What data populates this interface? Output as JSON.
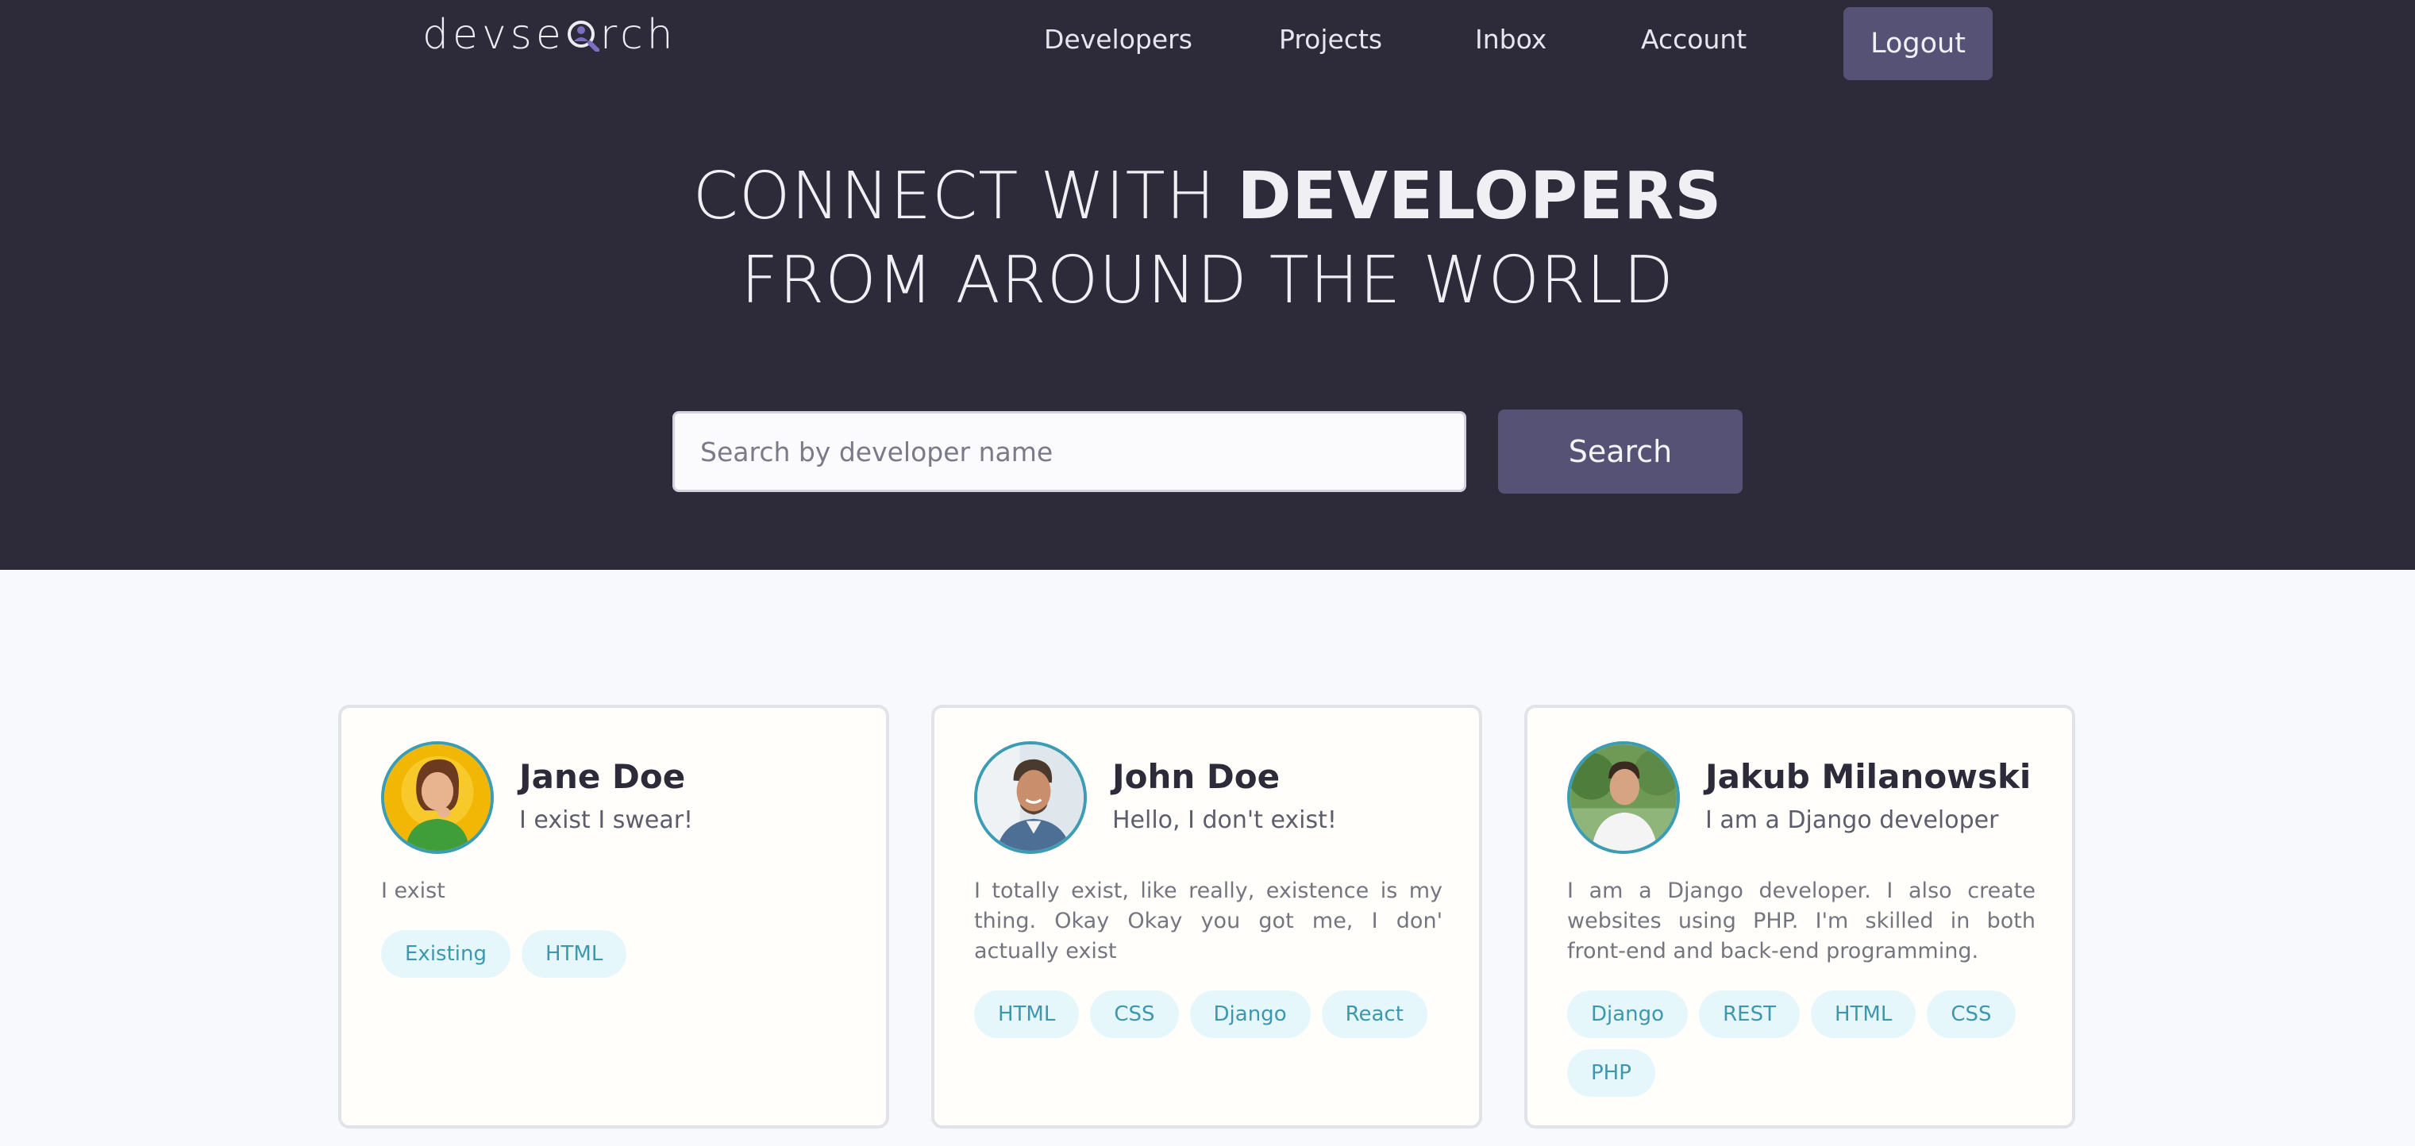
{
  "brand": {
    "logo_text_left": "devse",
    "logo_text_right": "rch"
  },
  "nav": {
    "items": [
      {
        "label": "Developers"
      },
      {
        "label": "Projects"
      },
      {
        "label": "Inbox"
      },
      {
        "label": "Account"
      }
    ],
    "logout_label": "Logout"
  },
  "hero": {
    "line1_light": "CONNECT WITH ",
    "line1_bold": "DEVELOPERS",
    "line2": "FROM AROUND THE WORLD"
  },
  "search": {
    "placeholder": "Search by developer name",
    "value": "",
    "button_label": "Search"
  },
  "colors": {
    "hero_bg": "#2d2a3a",
    "accent": "#565275",
    "tag_bg": "#e5f7fb",
    "tag_text": "#3e97ad",
    "avatar_ring": "#3b9cb4"
  },
  "developers": [
    {
      "name": "Jane Doe",
      "headline": "I exist I swear!",
      "bio": "I exist",
      "skills": [
        "Existing",
        "HTML"
      ],
      "avatar": "jane-avatar-photo"
    },
    {
      "name": "John Doe",
      "headline": "Hello, I don't exist!",
      "bio": "I totally exist, like really, existence is my thing. Okay Okay you got me, I don' actually exist",
      "skills": [
        "HTML",
        "CSS",
        "Django",
        "React"
      ],
      "avatar": "john-avatar-photo"
    },
    {
      "name": "Jakub Milanowski",
      "headline": "I am a Django developer",
      "bio": "I am a Django developer. I also create websites using PHP. I'm skilled in both front-end and back-end programming.",
      "skills": [
        "Django",
        "REST",
        "HTML",
        "CSS",
        "PHP"
      ],
      "avatar": "jakub-avatar-photo"
    }
  ]
}
